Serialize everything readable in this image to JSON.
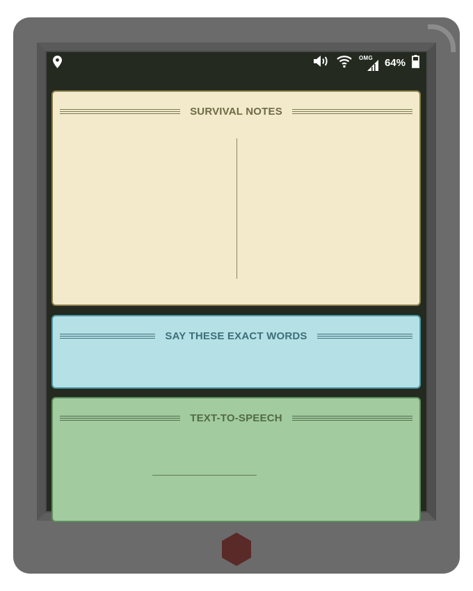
{
  "status_bar": {
    "network_label": "OMG",
    "battery_percent": "64%",
    "icons": [
      "location-pin-icon",
      "volume-icon",
      "wifi-icon",
      "signal-icon",
      "battery-icon"
    ]
  },
  "panels": {
    "survival_notes": {
      "title": "SURVIVAL NOTES"
    },
    "say_exact_words": {
      "title": "SAY THESE EXACT WORDS"
    },
    "text_to_speech": {
      "title": "TEXT-TO-SPEECH"
    }
  },
  "colors": {
    "device_body": "#6b6b6b",
    "screen_bg": "#242a20",
    "survival_panel": "#f2eacb",
    "say_panel": "#b5e1e6",
    "tts_panel": "#a2cb9f",
    "home_button": "#5a2a28"
  }
}
